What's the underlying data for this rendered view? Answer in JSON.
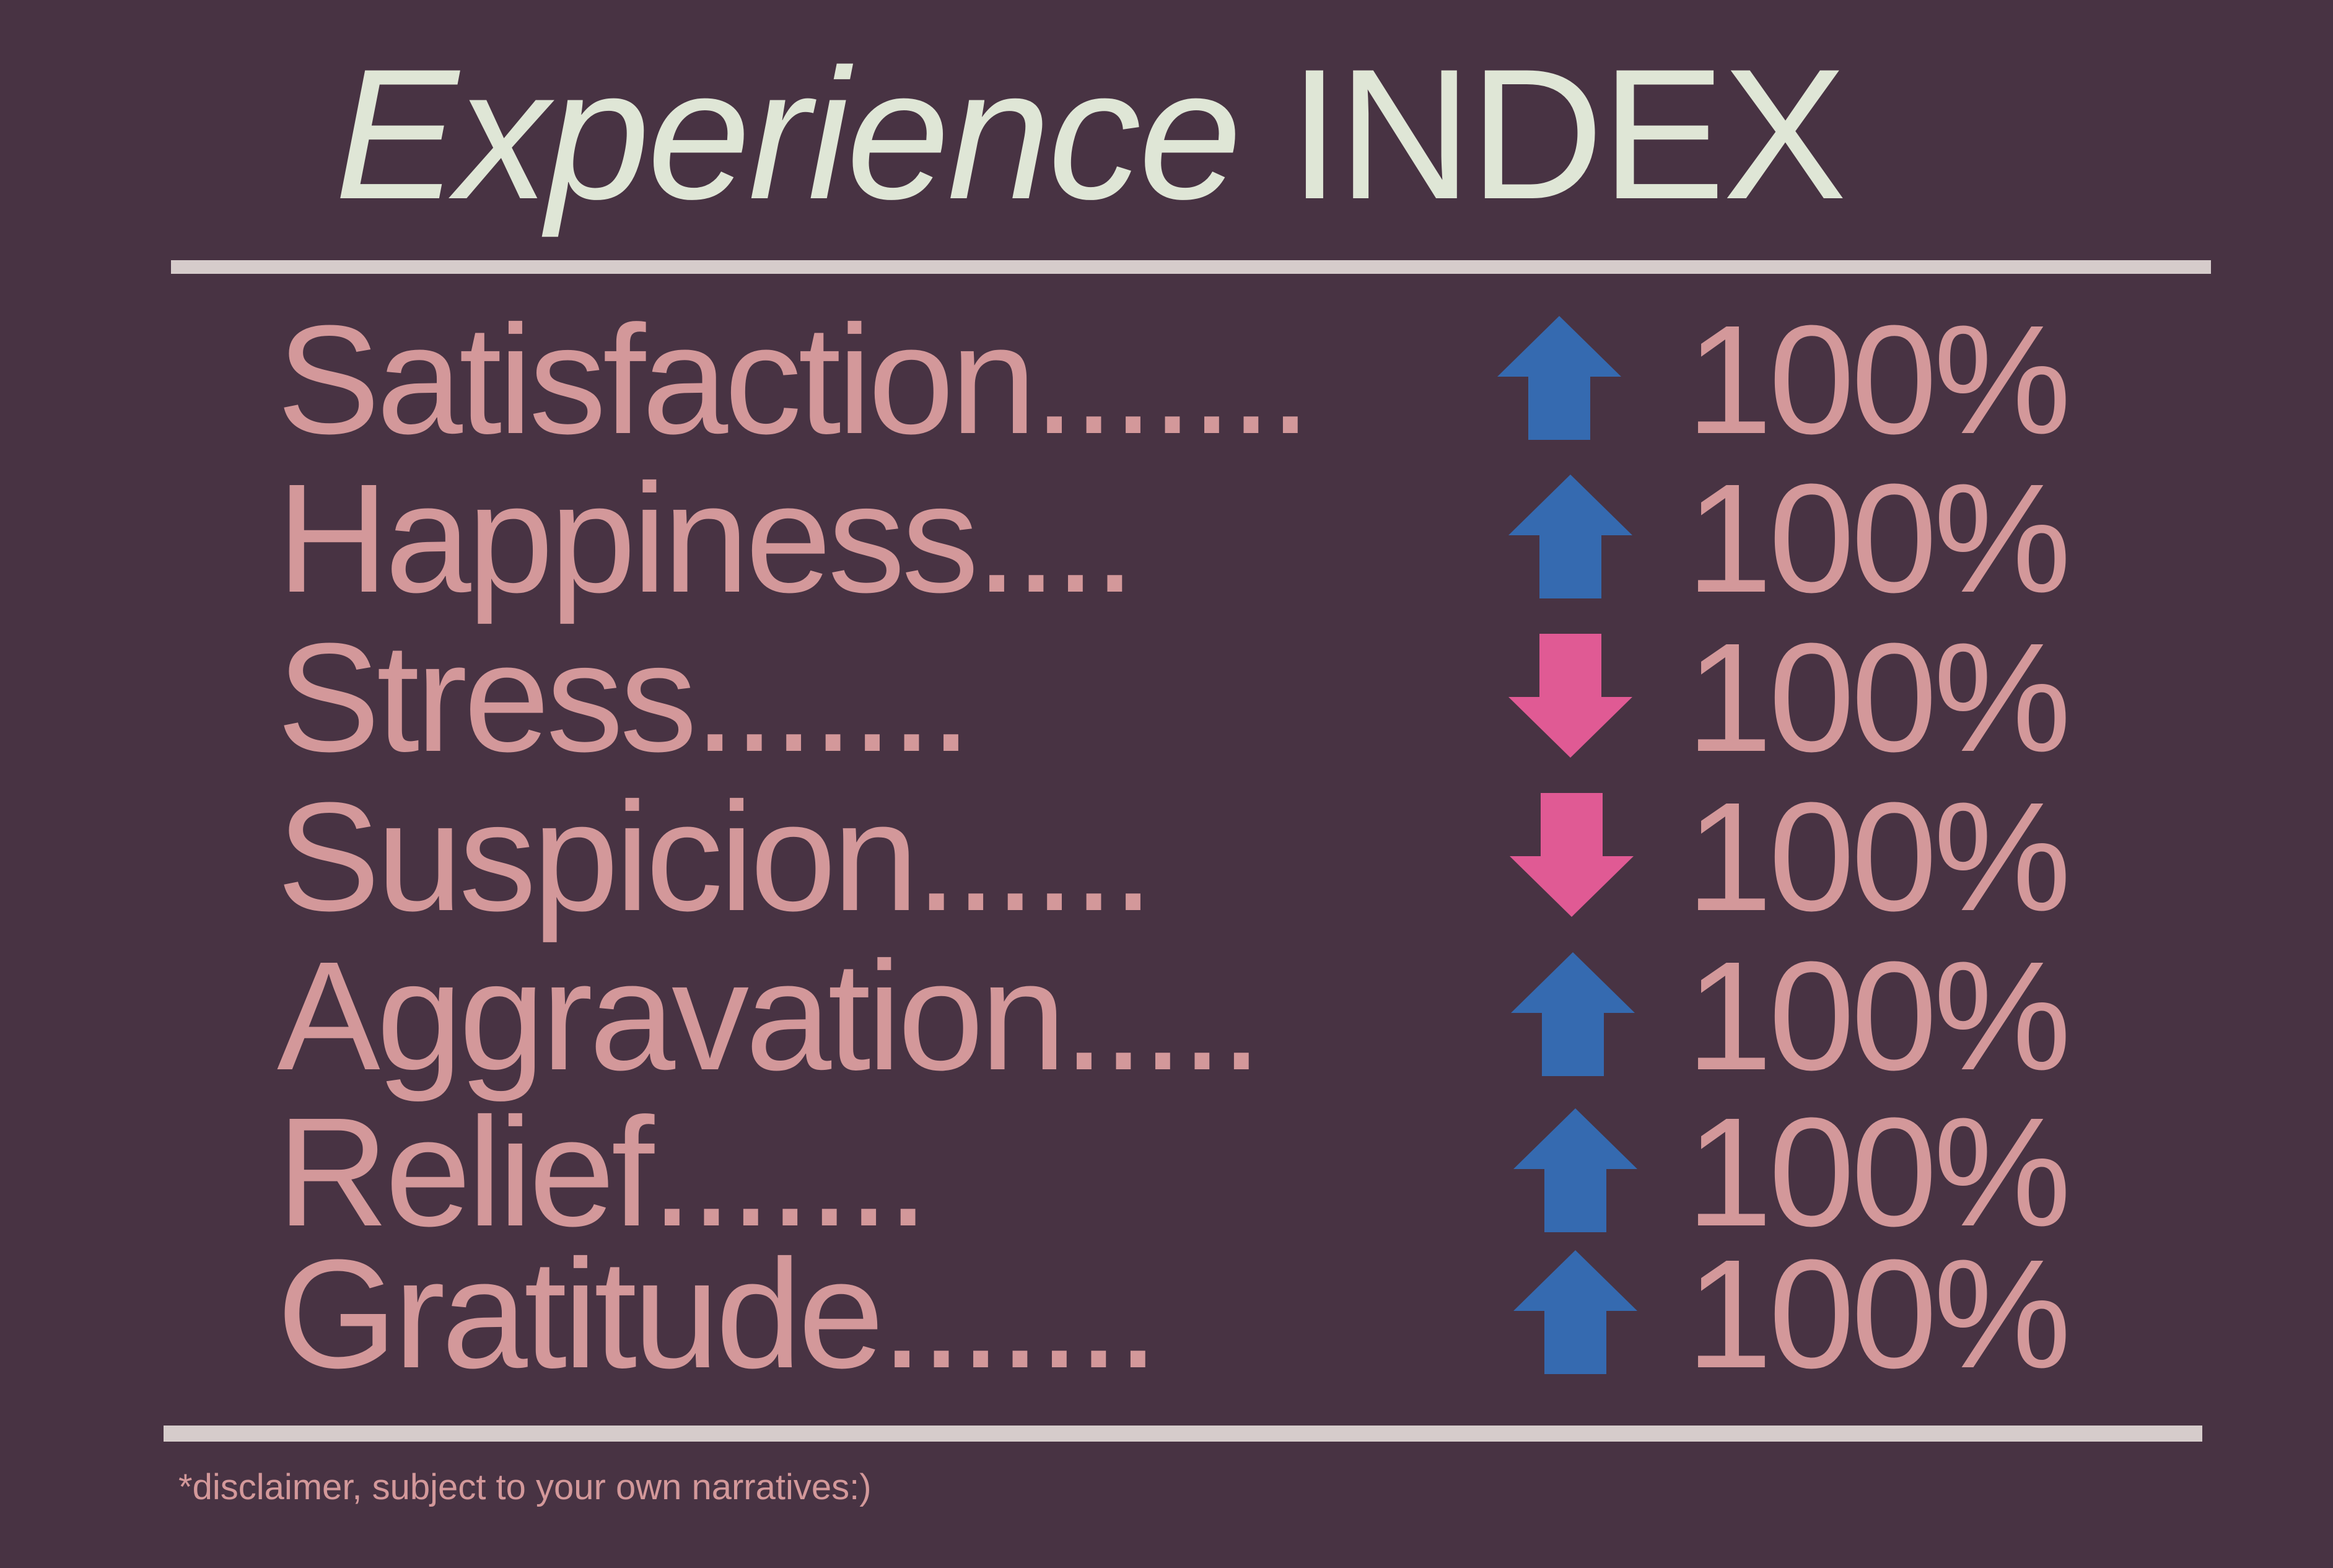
{
  "title": {
    "italic": "Experience",
    "regular": "INDEX"
  },
  "colors": {
    "background": "#483343",
    "text": "#d3989a",
    "title": "#dfe6d6",
    "rule": "#d6cccb",
    "up": "#356ab0",
    "down": "#e05a94"
  },
  "rows": [
    {
      "label": "Satisfaction.......",
      "direction": "up",
      "icon": "arrow-up-icon",
      "value": "100%"
    },
    {
      "label": "Happiness....",
      "direction": "up",
      "icon": "arrow-up-icon",
      "value": "100%"
    },
    {
      "label": "Stress.......",
      "direction": "down",
      "icon": "arrow-down-icon",
      "value": "100%"
    },
    {
      "label": "Suspicion......",
      "direction": "down",
      "icon": "arrow-down-icon",
      "value": "100%"
    },
    {
      "label": "Aggravation.....",
      "direction": "up",
      "icon": "arrow-up-icon",
      "value": "100%"
    },
    {
      "label": "Relief.......",
      "direction": "up",
      "icon": "arrow-up-icon",
      "value": "100%"
    },
    {
      "label": "Gratitude.......",
      "direction": "up",
      "icon": "arrow-up-icon",
      "value": "100%"
    }
  ],
  "disclaimer": "*disclaimer, subject to your own narratives:)"
}
